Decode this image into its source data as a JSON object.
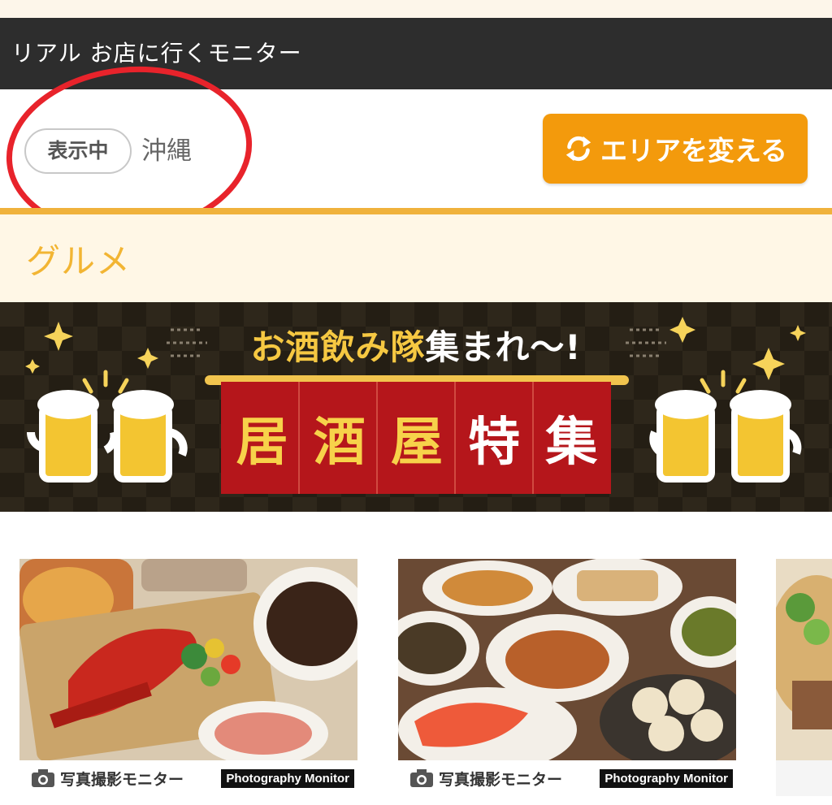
{
  "header": {
    "title": "リアル お店に行くモニター"
  },
  "area": {
    "status_badge": "表示中",
    "current_area": "沖縄",
    "change_button_label": "エリアを変える"
  },
  "section": {
    "title": "グルメ"
  },
  "banner": {
    "subtitle_part1": "お酒飲み隊",
    "subtitle_part2": "集まれ〜!",
    "main_chars": [
      "居",
      "酒",
      "屋",
      "特",
      "集"
    ]
  },
  "cards": [
    {
      "label": "写真撮影モニター",
      "tag": "Photography Monitor"
    },
    {
      "label": "写真撮影モニター",
      "tag": "Photography Monitor"
    }
  ],
  "colors": {
    "header_bg": "#2d2d2d",
    "accent_orange": "#f39a0c",
    "section_title": "#f2b533",
    "banner_red": "#b5161b",
    "annotation_red": "#e8232b"
  },
  "icons": {
    "change_button": "refresh-icon",
    "card_label": "camera-icon",
    "banner_decoration": "beer-mug-icon"
  }
}
